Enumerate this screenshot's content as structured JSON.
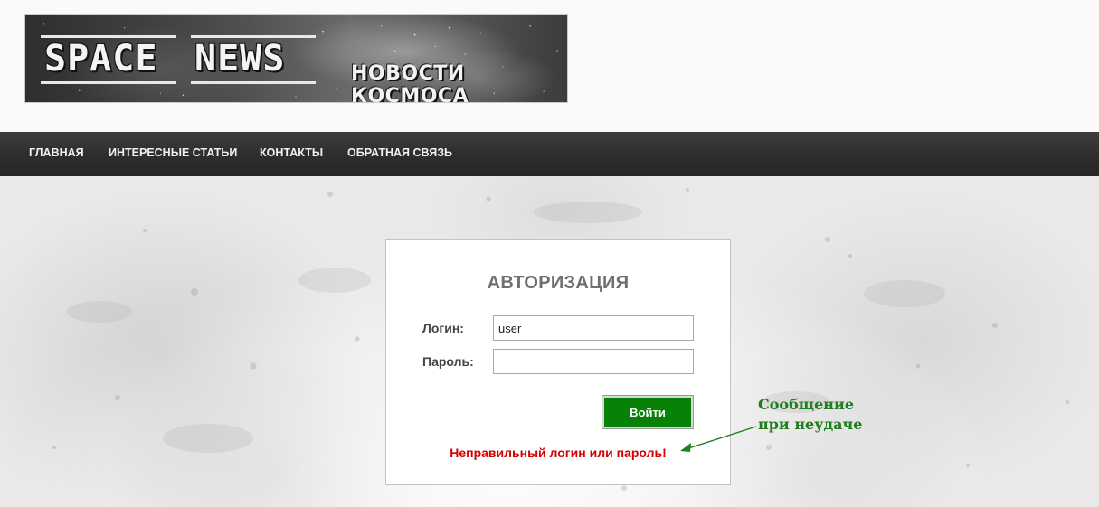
{
  "header": {
    "logo_word_1": "SPACE",
    "logo_word_2": "NEWS",
    "logo_subtitle": "НОВОСТИ КОСМОСА"
  },
  "nav": {
    "items": [
      {
        "label": "ГЛАВНАЯ"
      },
      {
        "label": "ИНТЕРЕСНЫЕ СТАТЬИ"
      },
      {
        "label": "КОНТАКТЫ"
      },
      {
        "label": "ОБРАТНАЯ СВЯЗЬ"
      }
    ]
  },
  "login": {
    "title": "АВТОРИЗАЦИЯ",
    "login_label": "Логин:",
    "login_value": "user",
    "password_label": "Пароль:",
    "password_value": "",
    "submit_label": "Войти",
    "error_message": "Неправильный логин или пароль!"
  },
  "annotation": {
    "line_1": "Сообщение",
    "line_2": "при неудаче"
  },
  "colors": {
    "nav_bg": "#2e2e2e",
    "button_green": "#078207",
    "error_red": "#d40000",
    "annotation_green": "#1f7f1f"
  }
}
